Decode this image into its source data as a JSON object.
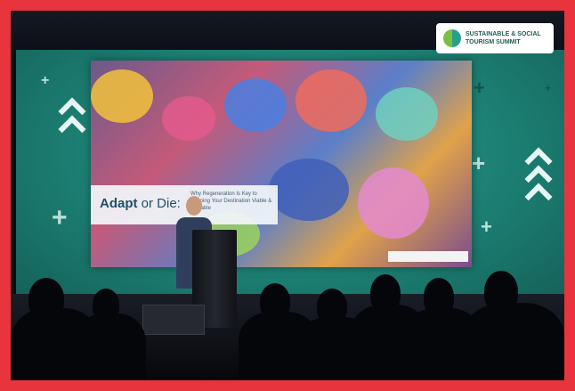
{
  "logo": {
    "line1": "SUSTAINABLE & SOCIAL",
    "line2": "TOURISM SUMMIT"
  },
  "slide": {
    "title_part1": "Adapt",
    "title_part2": " or Die:",
    "subtitle": "Why Regeneration Is Key to Keeping Your Destination Viable & Valuable"
  },
  "colors": {
    "border": "#e8343c",
    "screen_teal": "#1c7f73",
    "title_text": "#1f4e6b"
  },
  "icons": [
    "plus-icon",
    "chevron-up-icon"
  ]
}
